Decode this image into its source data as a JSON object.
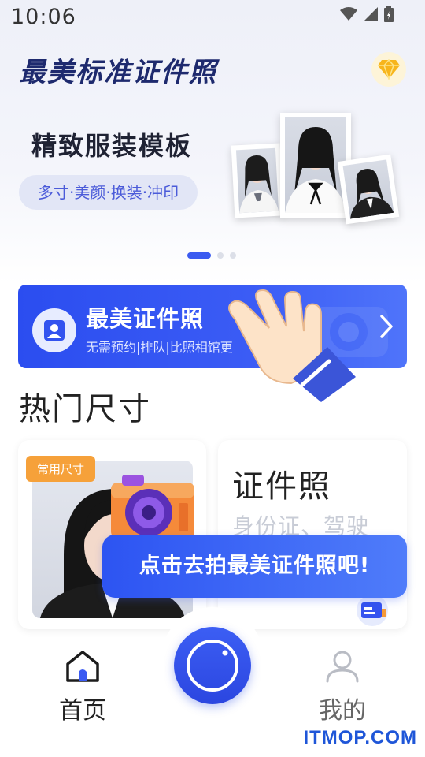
{
  "status_bar": {
    "time": "10:06",
    "icons": [
      "wifi-icon",
      "signal-icon",
      "battery-icon"
    ]
  },
  "header": {
    "title": "最美标准证件照",
    "vip_icon": "diamond-icon"
  },
  "banner": {
    "title": "精致服装模板",
    "tag": "多寸·美颜·换装·冲印",
    "pagination": {
      "count": 3,
      "active": 0
    }
  },
  "feature_card": {
    "title": "最美证件照",
    "subtitle": "无需预约|排队|比照相馆更",
    "icon": "id-photo-icon"
  },
  "hot_sizes": {
    "title": "热门尺寸",
    "cards": [
      {
        "badge": "常用尺寸"
      },
      {
        "title": "证件照",
        "subtitle": "身份证、驾驶"
      }
    ]
  },
  "tooltip": {
    "text": "点击去拍最美证件照吧!"
  },
  "bottom_nav": {
    "home_label": "首页",
    "mine_label": "我的",
    "camera_icon": "camera-shutter-icon"
  },
  "watermark": "ITMOP.COM",
  "colors": {
    "primary": "#2f4ff0",
    "accent_orange": "#f6a13a",
    "title_navy": "#1e2a6e"
  }
}
